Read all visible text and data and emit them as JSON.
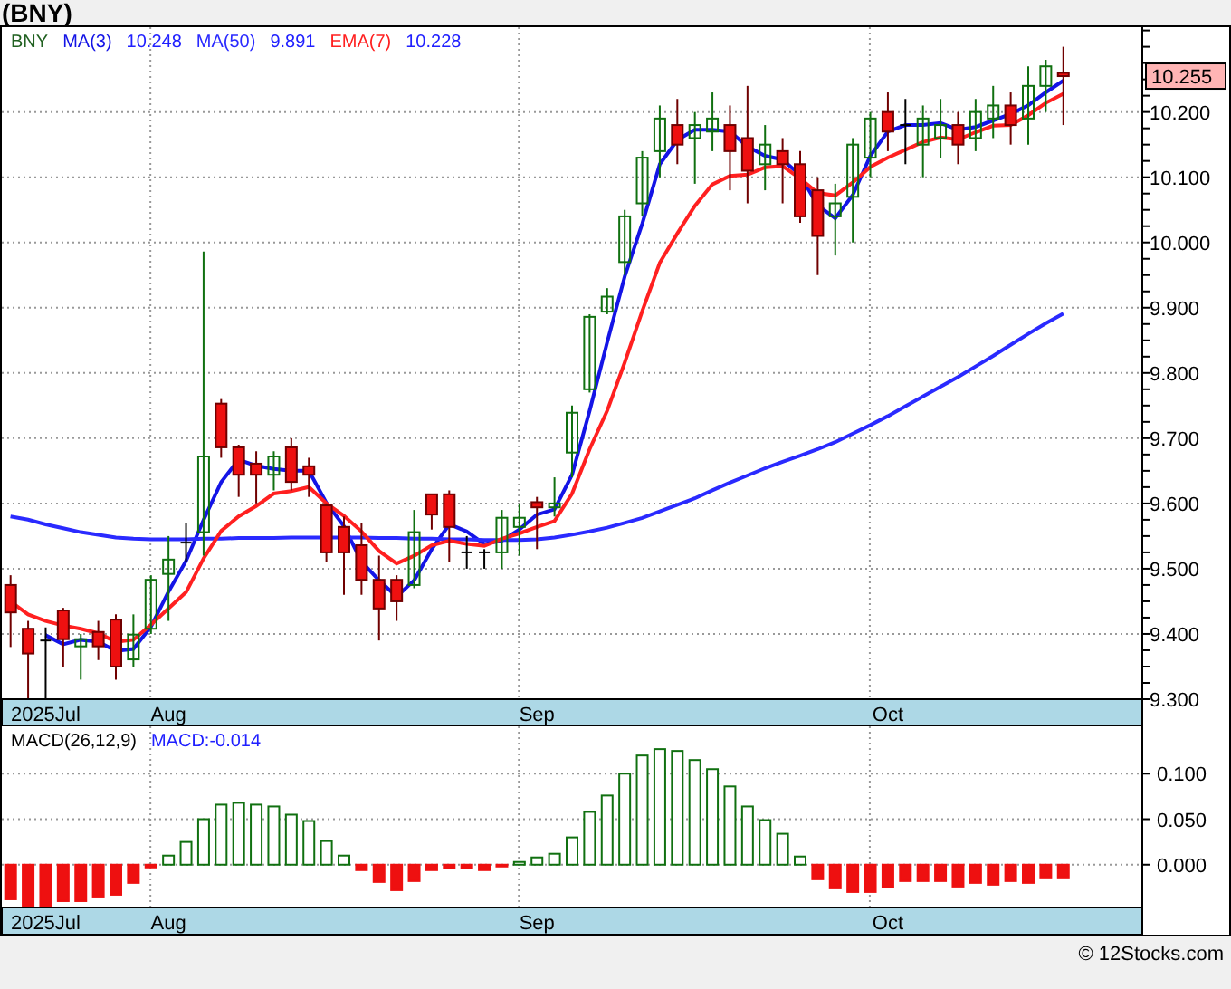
{
  "title": "(BNY)",
  "price_panel": {
    "symbol": "BNY",
    "legend_values": [
      "10.248",
      "9.891",
      "10.228"
    ],
    "last_price": "10.255",
    "chart_data": {
      "type": "candlestick",
      "grid": true,
      "categories": [
        null,
        null,
        "2025Jul",
        null,
        null,
        null,
        null,
        null,
        null,
        "Aug",
        null,
        null,
        null,
        null,
        null,
        null,
        null,
        null,
        null,
        null,
        null,
        null,
        null,
        null,
        null,
        null,
        null,
        null,
        null,
        null,
        "Sep",
        null,
        null,
        null,
        null,
        null,
        null,
        null,
        null,
        null,
        null,
        null,
        null,
        null,
        null,
        null,
        null,
        null,
        null,
        null,
        "Oct",
        null,
        null,
        null,
        null,
        null,
        null,
        null,
        null,
        null,
        null,
        null,
        null,
        null,
        null
      ],
      "ylim": [
        9.3,
        10.33
      ],
      "yticks": [
        {
          "value": 9.3,
          "label": "9.300"
        },
        {
          "value": 9.4,
          "label": "9.400"
        },
        {
          "value": 9.5,
          "label": "9.500"
        },
        {
          "value": 9.6,
          "label": "9.600"
        },
        {
          "value": 9.7,
          "label": "9.700"
        },
        {
          "value": 9.8,
          "label": "9.800"
        },
        {
          "value": 9.9,
          "label": "9.900"
        },
        {
          "value": 10.0,
          "label": "10.000"
        },
        {
          "value": 10.1,
          "label": "10.100"
        },
        {
          "value": 10.2,
          "label": "10.200"
        }
      ],
      "ohlc": [
        [
          9.475,
          9.49,
          9.38,
          9.433
        ],
        [
          9.408,
          9.42,
          9.3,
          9.37
        ],
        [
          9.39,
          9.41,
          9.3,
          9.39
        ],
        [
          9.436,
          9.44,
          9.35,
          9.392
        ],
        [
          9.381,
          9.4,
          9.33,
          9.392
        ],
        [
          9.403,
          9.42,
          9.36,
          9.381
        ],
        [
          9.422,
          9.43,
          9.33,
          9.35
        ],
        [
          9.361,
          9.43,
          9.35,
          9.399
        ],
        [
          9.408,
          9.49,
          9.4,
          9.483
        ],
        [
          9.492,
          9.55,
          9.42,
          9.514
        ],
        [
          9.54,
          9.57,
          9.51,
          9.54
        ],
        [
          9.556,
          9.986,
          9.52,
          9.672
        ],
        [
          9.753,
          9.76,
          9.67,
          9.686
        ],
        [
          9.686,
          9.69,
          9.61,
          9.644
        ],
        [
          9.661,
          9.68,
          9.6,
          9.644
        ],
        [
          9.644,
          9.68,
          9.62,
          9.672
        ],
        [
          9.686,
          9.7,
          9.62,
          9.633
        ],
        [
          9.657,
          9.67,
          9.61,
          9.644
        ],
        [
          9.597,
          9.6,
          9.51,
          9.525
        ],
        [
          9.564,
          9.58,
          9.46,
          9.525
        ],
        [
          9.536,
          9.57,
          9.46,
          9.483
        ],
        [
          9.483,
          9.52,
          9.39,
          9.439
        ],
        [
          9.483,
          9.49,
          9.42,
          9.45
        ],
        [
          9.475,
          9.59,
          9.47,
          9.556
        ],
        [
          9.614,
          9.614,
          9.56,
          9.583
        ],
        [
          9.614,
          9.62,
          9.51,
          9.564
        ],
        [
          9.525,
          9.55,
          9.5,
          9.525
        ],
        [
          9.525,
          9.53,
          9.5,
          9.525
        ],
        [
          9.525,
          9.59,
          9.5,
          9.578
        ],
        [
          9.564,
          9.6,
          9.52,
          9.578
        ],
        [
          9.602,
          9.61,
          9.53,
          9.594
        ],
        [
          9.594,
          9.64,
          9.58,
          9.6
        ],
        [
          9.678,
          9.75,
          9.64,
          9.739
        ],
        [
          9.775,
          9.89,
          9.77,
          9.886
        ],
        [
          9.894,
          9.93,
          9.89,
          9.917
        ],
        [
          9.97,
          10.05,
          9.95,
          10.04
        ],
        [
          10.06,
          10.14,
          10.04,
          10.13
        ],
        [
          10.14,
          10.21,
          10.1,
          10.19
        ],
        [
          10.18,
          10.22,
          10.12,
          10.15
        ],
        [
          10.16,
          10.2,
          10.09,
          10.18
        ],
        [
          10.17,
          10.23,
          10.14,
          10.19
        ],
        [
          10.18,
          10.21,
          10.08,
          10.14
        ],
        [
          10.16,
          10.24,
          10.06,
          10.11
        ],
        [
          10.12,
          10.18,
          10.08,
          10.15
        ],
        [
          10.14,
          10.16,
          10.06,
          10.12
        ],
        [
          10.12,
          10.14,
          10.03,
          10.04
        ],
        [
          10.08,
          10.1,
          9.95,
          10.01
        ],
        [
          10.04,
          10.09,
          9.98,
          10.06
        ],
        [
          10.07,
          10.16,
          10.0,
          10.15
        ],
        [
          10.13,
          10.2,
          10.1,
          10.19
        ],
        [
          10.2,
          10.23,
          10.14,
          10.17
        ],
        [
          10.18,
          10.22,
          10.12,
          10.18
        ],
        [
          10.15,
          10.21,
          10.1,
          10.19
        ],
        [
          10.16,
          10.22,
          10.13,
          10.18
        ],
        [
          10.18,
          10.2,
          10.12,
          10.15
        ],
        [
          10.16,
          10.22,
          10.14,
          10.2
        ],
        [
          10.19,
          10.24,
          10.16,
          10.21
        ],
        [
          10.21,
          10.23,
          10.15,
          10.18
        ],
        [
          10.19,
          10.27,
          10.15,
          10.24
        ],
        [
          10.24,
          10.28,
          10.2,
          10.27
        ],
        [
          10.26,
          10.3,
          10.18,
          10.255
        ],
        null,
        null,
        null,
        null
      ],
      "series": [
        {
          "name": "MA(3)",
          "type": "line",
          "color": "#1414e6",
          "values": [
            null,
            null,
            9.398,
            9.384,
            9.391,
            9.388,
            9.374,
            9.377,
            9.411,
            9.465,
            9.512,
            9.575,
            9.633,
            9.667,
            9.658,
            9.653,
            9.65,
            9.65,
            9.601,
            9.565,
            9.511,
            9.482,
            9.457,
            9.482,
            9.53,
            9.568,
            9.557,
            9.538,
            9.543,
            9.56,
            9.583,
            9.591,
            9.644,
            9.742,
            9.847,
            9.948,
            10.029,
            10.12,
            10.157,
            10.173,
            10.173,
            10.17,
            10.147,
            10.133,
            10.127,
            10.103,
            10.057,
            10.037,
            10.073,
            10.133,
            10.17,
            10.18,
            10.18,
            10.183,
            10.173,
            10.177,
            10.187,
            10.197,
            10.21,
            10.23,
            10.248,
            null,
            null,
            null,
            null
          ]
        },
        {
          "name": "MA(50)",
          "type": "line",
          "color": "#2a2aff",
          "values": [
            9.58,
            9.575,
            9.568,
            9.562,
            9.556,
            9.552,
            9.548,
            9.546,
            9.545,
            9.545,
            9.545,
            9.546,
            9.546,
            9.547,
            9.547,
            9.547,
            9.548,
            9.548,
            9.548,
            9.548,
            9.548,
            9.547,
            9.547,
            9.546,
            9.546,
            9.545,
            9.545,
            9.544,
            9.544,
            9.544,
            9.545,
            9.548,
            9.552,
            9.557,
            9.563,
            9.57,
            9.578,
            9.588,
            9.598,
            9.608,
            9.62,
            9.632,
            9.643,
            9.654,
            9.664,
            9.673,
            9.683,
            9.694,
            9.707,
            9.72,
            9.734,
            9.749,
            9.764,
            9.779,
            9.794,
            9.81,
            9.826,
            9.843,
            9.86,
            9.876,
            9.891,
            null,
            null,
            null,
            null
          ]
        },
        {
          "name": "EMA(7)",
          "type": "line",
          "color": "#ff2020",
          "values": [
            9.45,
            9.43,
            9.42,
            9.413,
            9.408,
            9.401,
            9.388,
            9.391,
            9.414,
            9.439,
            9.464,
            9.516,
            9.558,
            9.58,
            9.596,
            9.615,
            9.619,
            9.625,
            9.6,
            9.581,
            9.557,
            9.527,
            9.508,
            9.52,
            9.536,
            9.543,
            9.538,
            9.535,
            9.546,
            9.554,
            9.564,
            9.573,
            9.615,
            9.683,
            9.742,
            9.816,
            9.895,
            9.969,
            10.014,
            10.056,
            10.089,
            10.102,
            10.104,
            10.115,
            10.117,
            10.098,
            10.076,
            10.072,
            10.092,
            10.116,
            10.13,
            10.142,
            10.154,
            10.161,
            10.158,
            10.169,
            10.179,
            10.18,
            10.195,
            10.214,
            10.228,
            null,
            null,
            null,
            null
          ]
        }
      ]
    }
  },
  "macd_panel": {
    "reading": "MACD:-0.014",
    "chart_data": {
      "type": "bar",
      "grid": true,
      "categories": [
        null,
        null,
        "2025Jul",
        null,
        null,
        null,
        null,
        null,
        null,
        "Aug",
        null,
        null,
        null,
        null,
        null,
        null,
        null,
        null,
        null,
        null,
        null,
        null,
        null,
        null,
        null,
        null,
        null,
        null,
        null,
        null,
        "Sep",
        null,
        null,
        null,
        null,
        null,
        null,
        null,
        null,
        null,
        null,
        null,
        null,
        null,
        null,
        null,
        null,
        null,
        null,
        null,
        "Oct",
        null,
        null,
        null,
        null,
        null,
        null,
        null,
        null,
        null,
        null,
        null,
        null,
        null,
        null
      ],
      "ylim": [
        -0.047,
        0.152
      ],
      "yticks": [
        {
          "value": 0,
          "label": "0.000"
        },
        {
          "value": 0.05,
          "label": "0.050"
        },
        {
          "value": 0.1,
          "label": "0.100"
        }
      ],
      "series": [
        {
          "name": "MACD(26,12,9)",
          "color": "#107010",
          "values": [
            null,
            null,
            null,
            null,
            null,
            null,
            null,
            null,
            null,
            0.01,
            0.025,
            0.05,
            0.066,
            0.068,
            0.066,
            0.064,
            0.055,
            0.048,
            0.026,
            0.01,
            null,
            null,
            null,
            null,
            null,
            null,
            null,
            null,
            null,
            0.003,
            0.008,
            0.012,
            0.03,
            0.058,
            0.076,
            0.1,
            0.12,
            0.127,
            0.125,
            0.115,
            0.105,
            0.086,
            0.064,
            0.049,
            0.034,
            0.009,
            null,
            null,
            null,
            null,
            null,
            null,
            null,
            null,
            null,
            null,
            null,
            null,
            null,
            null,
            null,
            null,
            null,
            null,
            null
          ]
        },
        {
          "color": "#ee1010",
          "values": [
            -0.038,
            -0.045,
            -0.045,
            -0.04,
            -0.04,
            -0.035,
            -0.033,
            -0.02,
            -0.003,
            null,
            null,
            null,
            null,
            null,
            null,
            null,
            null,
            null,
            null,
            null,
            -0.006,
            -0.019,
            -0.028,
            -0.018,
            -0.006,
            -0.004,
            -0.004,
            -0.006,
            -0.002,
            null,
            null,
            null,
            null,
            null,
            null,
            null,
            null,
            null,
            null,
            null,
            null,
            null,
            null,
            null,
            null,
            null,
            -0.016,
            -0.026,
            -0.03,
            -0.03,
            -0.025,
            -0.018,
            -0.018,
            -0.018,
            -0.024,
            -0.02,
            -0.022,
            -0.018,
            -0.02,
            -0.014,
            -0.014,
            null,
            null,
            null,
            null
          ]
        }
      ]
    }
  },
  "footer": "© 12Stocks.com"
}
